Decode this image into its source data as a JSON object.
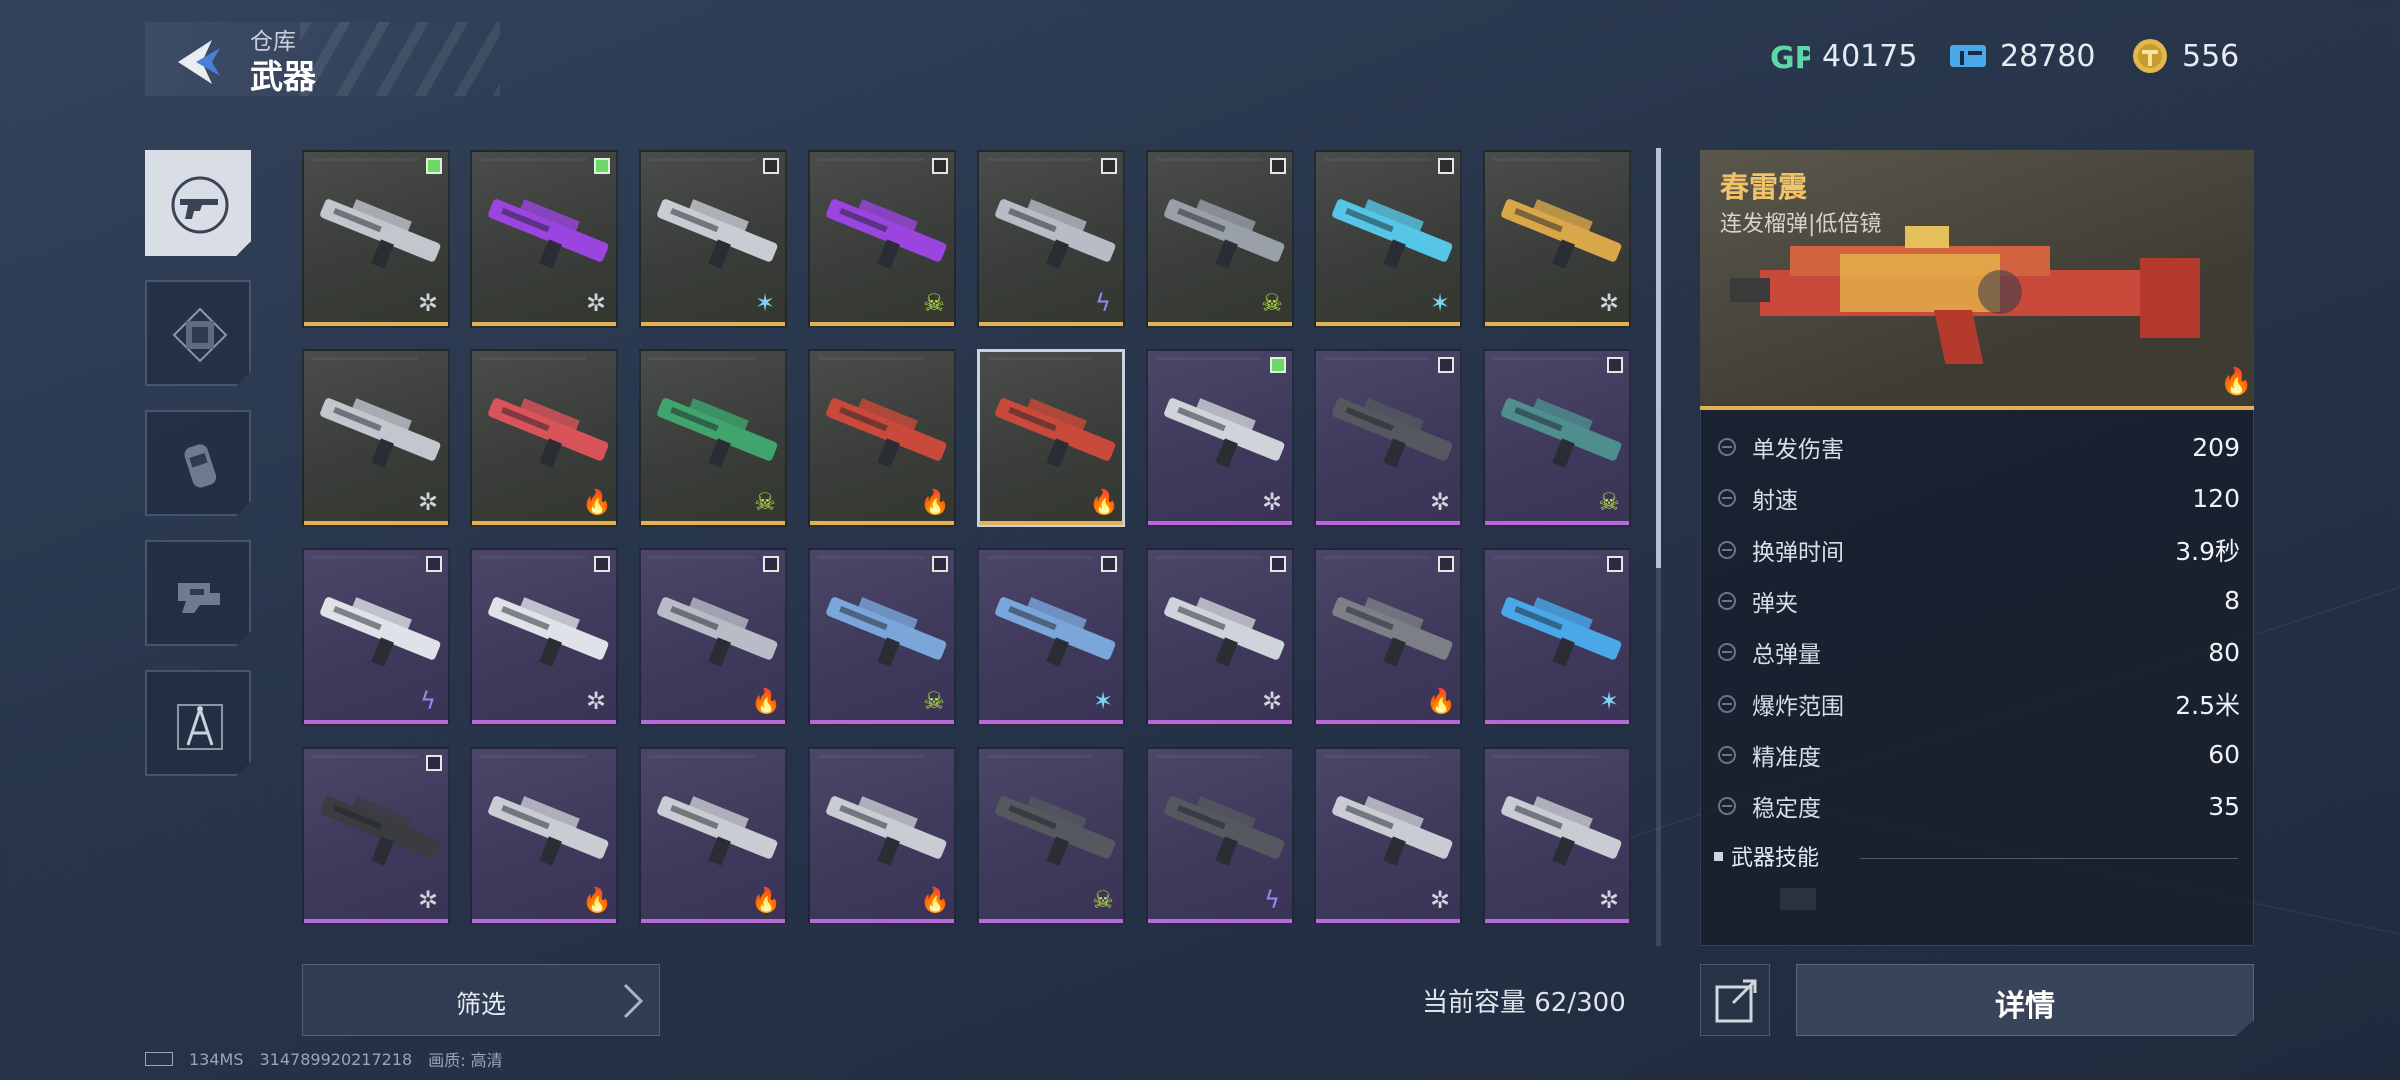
{
  "header": {
    "back_icon": "back-chevron-icon",
    "section": "仓库",
    "title": "武器"
  },
  "currencies": [
    {
      "icon": "gp-icon",
      "value": "40175"
    },
    {
      "icon": "ticket-icon",
      "value": "28780"
    },
    {
      "icon": "gold-coin-icon",
      "value": "556"
    }
  ],
  "categories": [
    {
      "name": "weapon",
      "icon": "gun-icon",
      "active": true
    },
    {
      "name": "frame",
      "icon": "frame-icon",
      "active": false
    },
    {
      "name": "canister",
      "icon": "grenade-icon",
      "active": false
    },
    {
      "name": "hand",
      "icon": "glove-icon",
      "active": false
    },
    {
      "name": "tool",
      "icon": "compass-icon",
      "active": false
    }
  ],
  "grid": {
    "rows": [
      [
        {
          "rarity": "gold",
          "check": "on",
          "element": "✲",
          "color": "#cfd6de",
          "shape": "rifle"
        },
        {
          "rarity": "gold",
          "check": "on",
          "element": "✲",
          "color": "#cfd6de",
          "shape": "purple-rifle"
        },
        {
          "rarity": "gold",
          "check": "off",
          "element": "✶",
          "color": "#7fd3f0",
          "shape": "gatling"
        },
        {
          "rarity": "gold",
          "check": "off",
          "element": "☠",
          "color": "#b6e24a",
          "shape": "purple-rifle"
        },
        {
          "rarity": "gold",
          "check": "off",
          "element": "ϟ",
          "color": "#8c8ff0",
          "shape": "pistol"
        },
        {
          "rarity": "gold",
          "check": "off",
          "element": "☠",
          "color": "#b6e24a",
          "shape": "scythe"
        },
        {
          "rarity": "gold",
          "check": "off",
          "element": "✶",
          "color": "#7fd3f0",
          "shape": "blade"
        },
        {
          "rarity": "gold",
          "check": "none",
          "element": "✲",
          "color": "#cfd6de",
          "shape": "gold-gun"
        }
      ],
      [
        {
          "rarity": "gold",
          "check": "none",
          "element": "✲",
          "color": "#cfd6de",
          "shape": "rifle"
        },
        {
          "rarity": "gold",
          "check": "none",
          "element": "🔥",
          "color": "#f0a63c",
          "shape": "swords"
        },
        {
          "rarity": "gold",
          "check": "none",
          "element": "☠",
          "color": "#b6e24a",
          "shape": "green-gun"
        },
        {
          "rarity": "gold",
          "check": "none",
          "element": "🔥",
          "color": "#f0a63c",
          "shape": "red-gun"
        },
        {
          "rarity": "gold",
          "check": "none",
          "element": "🔥",
          "color": "#f0a63c",
          "shape": "red-gun",
          "selected": true
        },
        {
          "rarity": "purple",
          "check": "on",
          "element": "✲",
          "color": "#cfd6de",
          "shape": "bow"
        },
        {
          "rarity": "purple",
          "check": "off",
          "element": "✲",
          "color": "#cfd6de",
          "shape": "dark-rifle"
        },
        {
          "rarity": "purple",
          "check": "off",
          "element": "☠",
          "color": "#b6e24a",
          "shape": "teal-rifle"
        }
      ],
      [
        {
          "rarity": "purple",
          "check": "off",
          "element": "ϟ",
          "color": "#8c8ff0",
          "shape": "white-gun"
        },
        {
          "rarity": "purple",
          "check": "off",
          "element": "✲",
          "color": "#cfd6de",
          "shape": "white-gun"
        },
        {
          "rarity": "purple",
          "check": "off",
          "element": "🔥",
          "color": "#f0a63c",
          "shape": "pistol"
        },
        {
          "rarity": "purple",
          "check": "off",
          "element": "☠",
          "color": "#b6e24a",
          "shape": "blue-gun"
        },
        {
          "rarity": "purple",
          "check": "off",
          "element": "✶",
          "color": "#7fd3f0",
          "shape": "blue-gun"
        },
        {
          "rarity": "purple",
          "check": "off",
          "element": "✲",
          "color": "#cfd6de",
          "shape": "bow"
        },
        {
          "rarity": "purple",
          "check": "off",
          "element": "🔥",
          "color": "#f0a63c",
          "shape": "knife"
        },
        {
          "rarity": "purple",
          "check": "off",
          "element": "✶",
          "color": "#7fd3f0",
          "shape": "wings"
        }
      ],
      [
        {
          "rarity": "purple",
          "check": "off",
          "element": "✲",
          "color": "#cfd6de",
          "shape": "flail"
        },
        {
          "rarity": "purple",
          "check": "none",
          "element": "🔥",
          "color": "#f0a63c",
          "shape": "gatling"
        },
        {
          "rarity": "purple",
          "check": "none",
          "element": "🔥",
          "color": "#f0a63c",
          "shape": "gatling"
        },
        {
          "rarity": "purple",
          "check": "none",
          "element": "🔥",
          "color": "#f0a63c",
          "shape": "gatling"
        },
        {
          "rarity": "purple",
          "check": "none",
          "element": "☠",
          "color": "#b6e24a",
          "shape": "dark-rifle"
        },
        {
          "rarity": "purple",
          "check": "none",
          "element": "ϟ",
          "color": "#8c8ff0",
          "shape": "dark-rifle"
        },
        {
          "rarity": "purple",
          "check": "none",
          "element": "✲",
          "color": "#cfd6de",
          "shape": "gatling"
        },
        {
          "rarity": "purple",
          "check": "none",
          "element": "✲",
          "color": "#cfd6de",
          "shape": "gatling"
        }
      ]
    ]
  },
  "detail": {
    "name": "春雷震",
    "type": "连发榴弹|低倍镜",
    "element_icon": "fire-icon",
    "stats": [
      {
        "label": "单发伤害",
        "value": "209",
        "icon": "damage-icon"
      },
      {
        "label": "射速",
        "value": "120",
        "icon": "firerate-icon"
      },
      {
        "label": "换弹时间",
        "value": "3.9秒",
        "icon": "reload-icon"
      },
      {
        "label": "弹夹",
        "value": "8",
        "icon": "magazine-icon"
      },
      {
        "label": "总弹量",
        "value": "80",
        "icon": "ammo-icon"
      },
      {
        "label": "爆炸范围",
        "value": "2.5米",
        "icon": "blast-icon"
      },
      {
        "label": "精准度",
        "value": "60",
        "icon": "crosshair-icon"
      },
      {
        "label": "稳定度",
        "value": "35",
        "icon": "stability-icon"
      }
    ],
    "skill_header": "武器技能"
  },
  "bottom": {
    "filter_label": "筛选",
    "capacity": "当前容量 62/300",
    "detail_button": "详情"
  },
  "footer": {
    "ping": "134MS",
    "uid": "314789920217218",
    "quality": "画质: 高清"
  },
  "colors": {
    "gold_rarity": "#e2b157",
    "purple_rarity": "#b56ad8",
    "check_on": "#6fd66a",
    "name_accent": "#f0c36a"
  }
}
